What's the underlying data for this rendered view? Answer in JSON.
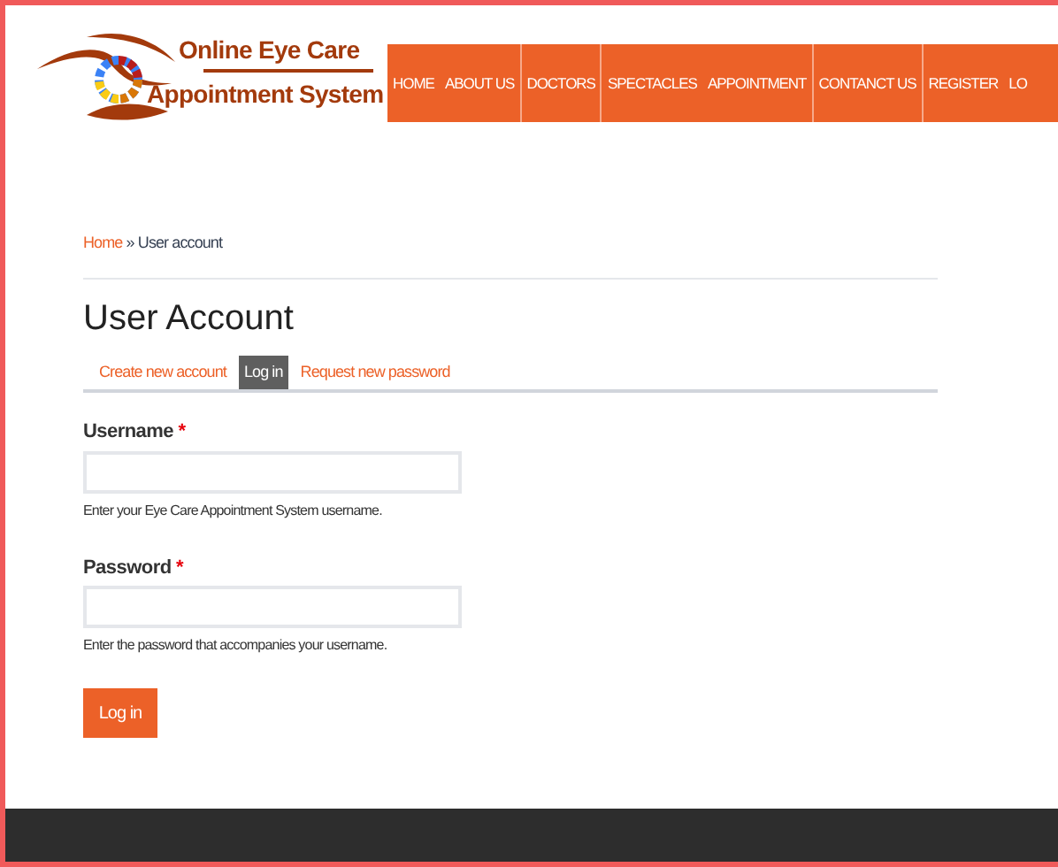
{
  "logo": {
    "line_1": "Online Eye Care",
    "line_2": "Appointment System"
  },
  "nav": [
    {
      "label": "HOME",
      "divider": false
    },
    {
      "label": "ABOUT US",
      "divider": false
    },
    {
      "label": "DOCTORS",
      "divider": true
    },
    {
      "label": "SPECTACLES",
      "divider": true
    },
    {
      "label": "APPOINTMENT",
      "divider": false
    },
    {
      "label": "CONTANCT US",
      "divider": true
    },
    {
      "label": "REGISTER",
      "divider": true
    },
    {
      "label": "LO",
      "divider": false
    }
  ],
  "breadcrumb": {
    "link": "Home",
    "separator": "»",
    "current": "User account"
  },
  "title": "User Account",
  "tabs": [
    {
      "label": "Create new account",
      "selected": false
    },
    {
      "label": "Log in",
      "selected": true
    },
    {
      "label": "Request new password",
      "selected": false
    }
  ],
  "fields": [
    {
      "label": "Username",
      "required": "*",
      "help": "Enter your Eye Care Appointment System username."
    },
    {
      "label": "Password",
      "required": "*",
      "help": "Enter the password that accompanies your username."
    }
  ],
  "submit": "Log in"
}
